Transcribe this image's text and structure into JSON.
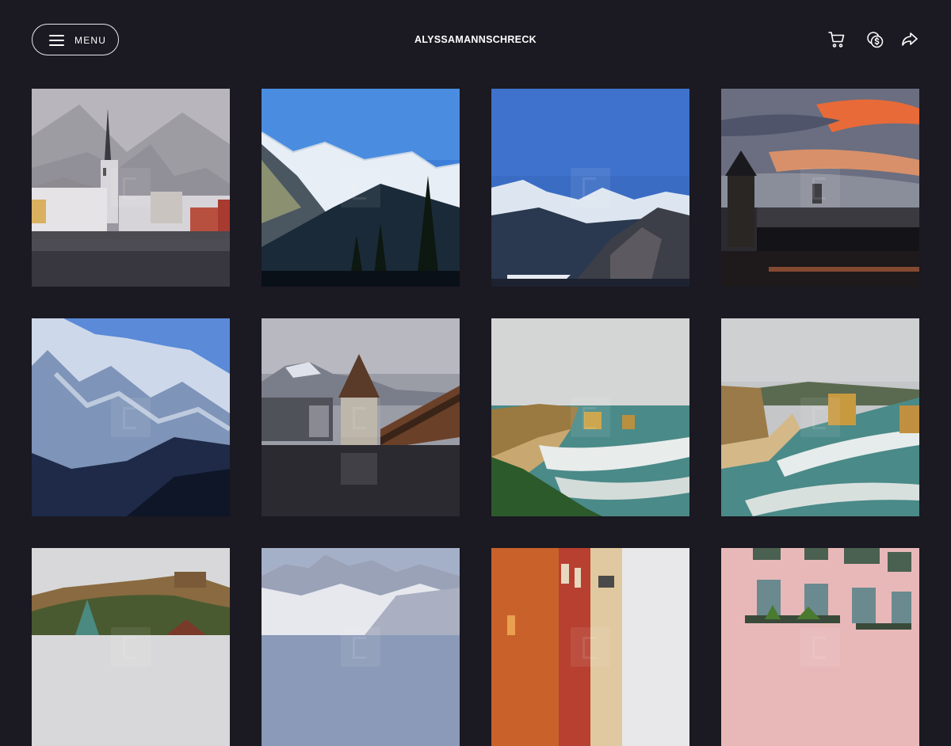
{
  "header": {
    "menu_label": "MENU",
    "site_title": "ALYSSAMANNSCHRECK",
    "icons": [
      "cart-icon",
      "currency-icon",
      "share-icon"
    ]
  },
  "colors": {
    "background": "#1b1921",
    "text": "#ffffff",
    "border": "#e8e8ec"
  },
  "gallery": {
    "tiles": [
      {
        "subject": "snowy village church lake"
      },
      {
        "subject": "snowy mountains blue sky pine"
      },
      {
        "subject": "mountain valley blue sky"
      },
      {
        "subject": "sunset tower bridge"
      },
      {
        "subject": "snowy mountain face"
      },
      {
        "subject": "water tower covered bridge"
      },
      {
        "subject": "coastal rocks surf"
      },
      {
        "subject": "coastal cliffs beach"
      },
      {
        "subject": "hill fort church"
      },
      {
        "subject": "snowy peaks"
      },
      {
        "subject": "colorful buildings street"
      },
      {
        "subject": "pink building balconies"
      }
    ]
  }
}
